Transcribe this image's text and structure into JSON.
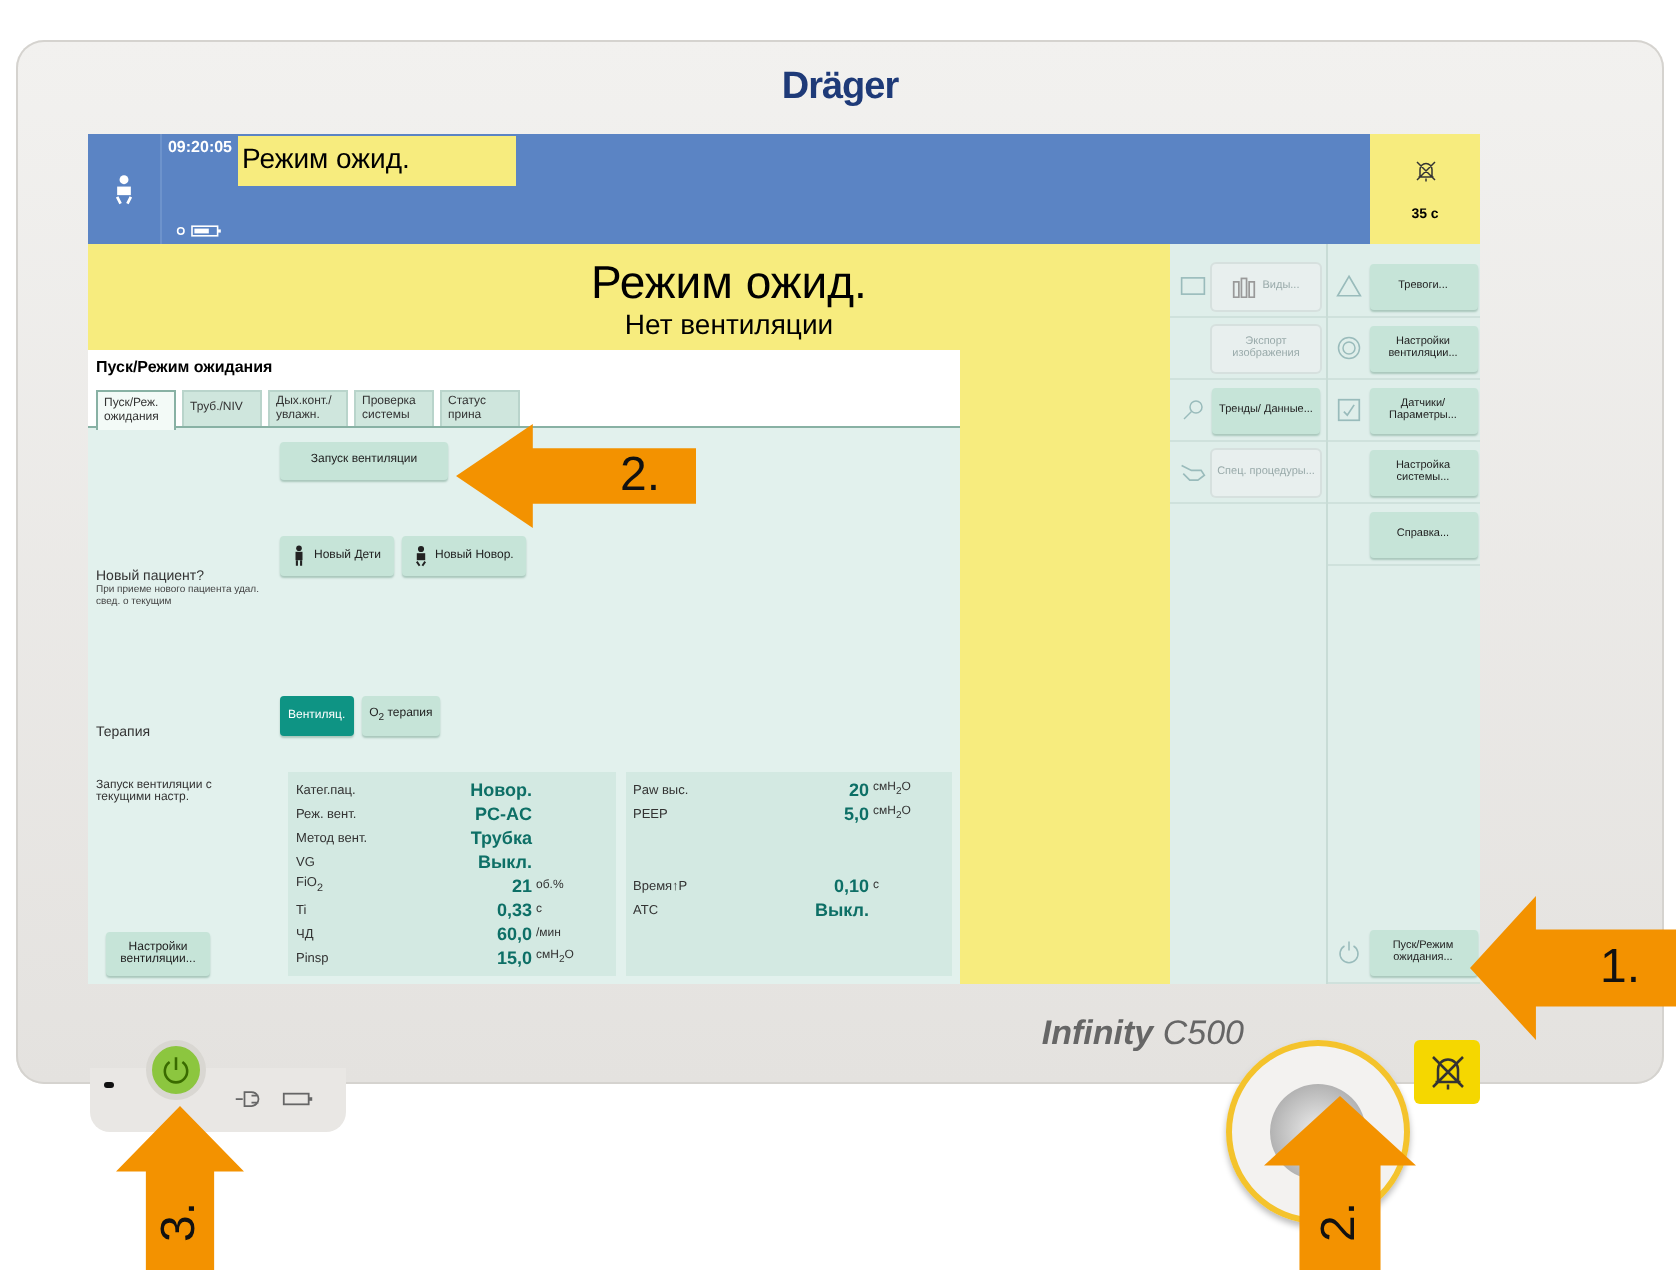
{
  "device": {
    "brand": "Dräger",
    "model_name": "Infinity",
    "model_number": "C500"
  },
  "header": {
    "time": "09:20:05",
    "status": "Режим ожид.",
    "alarm_timer": "35 с"
  },
  "banner": {
    "title": "Режим ожид.",
    "subtitle": "Нет вентиляции"
  },
  "dialog": {
    "title": "Пуск/Режим ожидания",
    "tabs": [
      {
        "label": "Пуск/Реж. ожидания",
        "selected": true
      },
      {
        "label": "Труб./NIV",
        "selected": false
      },
      {
        "label": "Дых.конт./ увлажн.",
        "selected": false
      },
      {
        "label": "Проверка системы",
        "selected": false
      },
      {
        "label": "Статус прина",
        "selected": false
      }
    ],
    "start_button": "Запуск вентиляции",
    "new_patient": {
      "label": "Новый пациент?",
      "hint": "При приеме нового пациента удал. свед. о текущим"
    },
    "patient_buttons": [
      {
        "label": "Новый Дети"
      },
      {
        "label": "Новый Новор."
      }
    ],
    "therapy": {
      "label": "Терапия"
    },
    "therapy_buttons": [
      {
        "label": "Вентиляц.",
        "selected": true
      },
      {
        "label": "O$_{2}$ терапия",
        "selected": false
      }
    ],
    "start_current": "Запуск вентиляции с текущими настр.",
    "settings_button": "Настройки вентиляции...",
    "params": [
      {
        "left": {
          "name": "Катег.пац.",
          "value": "Новор."
        },
        "right": {
          "name": "Paw выс.",
          "value": "20",
          "unit": "смH$_{2}$O"
        }
      },
      {
        "left": {
          "name": "Реж. вент.",
          "value": "PC-AC"
        },
        "right": {
          "name": "PEEP",
          "value": "5,0",
          "unit": "смH$_{2}$O"
        }
      },
      {
        "left": {
          "name": "Метод вент.",
          "value": "Трубка"
        }
      },
      {
        "left": {
          "name": "VG",
          "value": "Выкл."
        }
      },
      {
        "left": {
          "name": "FiO$_{2}$",
          "value": "21",
          "unit": "об.%"
        },
        "right": {
          "name": "Время↑P",
          "value": "0,10",
          "unit": "с"
        }
      },
      {
        "left": {
          "name": "Ti",
          "value": "0,33",
          "unit": "с"
        },
        "right": {
          "name": "ATC",
          "value": "Выкл."
        }
      },
      {
        "left": {
          "name": "ЧД",
          "value": "60,0",
          "unit": "/мин"
        }
      },
      {
        "left": {
          "name": "Pinsp",
          "value": "15,0",
          "unit": "смH$_{2}$O"
        }
      }
    ]
  },
  "menu": {
    "left": [
      {
        "label": "Виды...",
        "disabled": true
      },
      {
        "label": "Экспорт изображения",
        "disabled": true
      },
      {
        "label": "Тренды/ Данные...",
        "disabled": false
      },
      {
        "label": "Спец. процедуры...",
        "disabled": true
      }
    ],
    "right": [
      {
        "label": "Тревоги...",
        "disabled": false
      },
      {
        "label": "Настройки вентиляции...",
        "disabled": false
      },
      {
        "label": "Датчики/ Параметры...",
        "disabled": false
      },
      {
        "label": "Настройка системы...",
        "disabled": false
      },
      {
        "label": "Справка...",
        "disabled": false
      }
    ],
    "standby": {
      "label": "Пуск/Режим ожидания...",
      "disabled": false
    }
  },
  "callouts": [
    {
      "label": "2.",
      "kind": "left"
    },
    {
      "label": "1.",
      "kind": "left"
    },
    {
      "label": "3.",
      "kind": "up"
    },
    {
      "label": "2.",
      "kind": "up"
    }
  ]
}
